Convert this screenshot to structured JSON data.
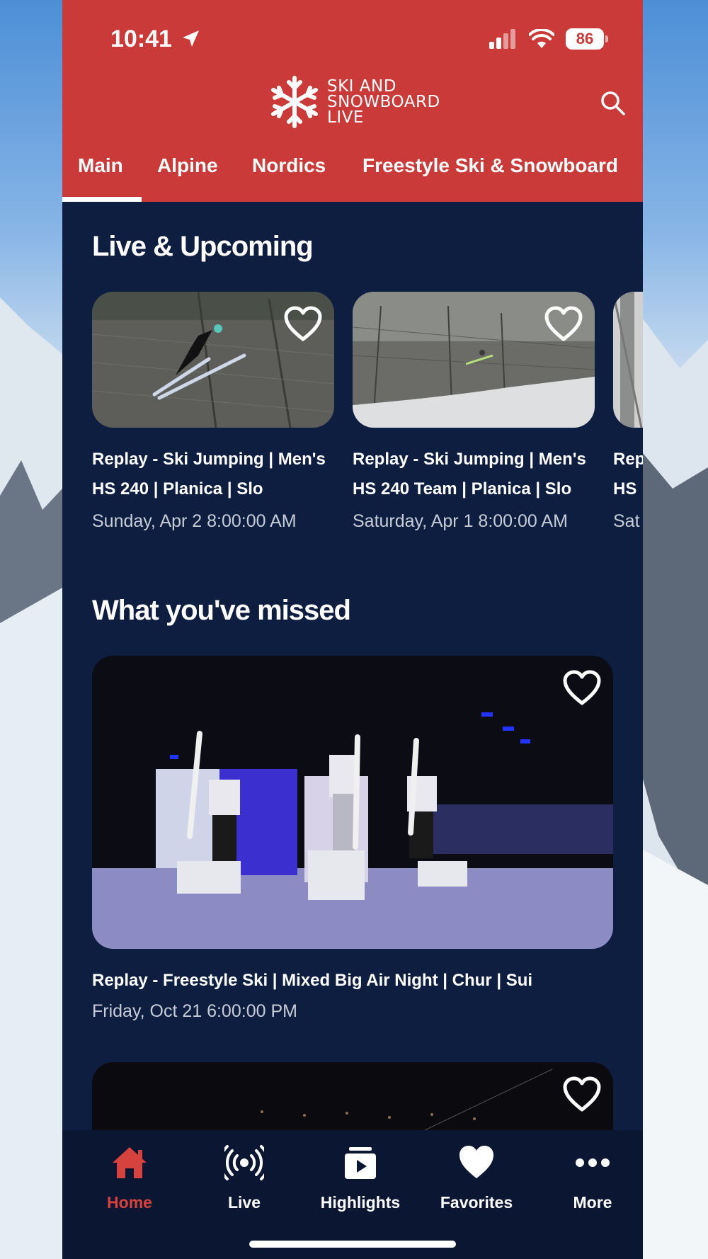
{
  "status": {
    "time": "10:41",
    "battery": "86"
  },
  "brand": {
    "line1": "SKI AND",
    "line2": "SNOWBOARD",
    "line3": "LIVE"
  },
  "tabs": [
    {
      "label": "Main"
    },
    {
      "label": "Alpine"
    },
    {
      "label": "Nordics"
    },
    {
      "label": "Freestyle Ski & Snowboard"
    }
  ],
  "sections": {
    "live": {
      "title": "Live & Upcoming",
      "cards": [
        {
          "title1": "Replay - Ski Jumping | Men's",
          "title2": "HS 240 | Planica | Slo",
          "date": "Sunday, Apr 2 8:00:00 AM"
        },
        {
          "title1": "Replay - Ski Jumping | Men's",
          "title2": "HS 240 Team | Planica | Slo",
          "date": "Saturday, Apr 1 8:00:00 AM"
        },
        {
          "title1": "Rep",
          "title2": "HS",
          "date": "Sat"
        }
      ]
    },
    "missed": {
      "title": "What you've missed",
      "cards": [
        {
          "title": "Replay - Freestyle Ski | Mixed Big Air Night | Chur | Sui",
          "date": "Friday, Oct 21 6:00:00 PM"
        }
      ]
    }
  },
  "tabbar": [
    {
      "label": "Home",
      "icon": "home-icon"
    },
    {
      "label": "Live",
      "icon": "broadcast-icon"
    },
    {
      "label": "Highlights",
      "icon": "highlights-icon"
    },
    {
      "label": "Favorites",
      "icon": "heart-icon"
    },
    {
      "label": "More",
      "icon": "more-icon"
    }
  ],
  "colors": {
    "header": "#c93a38",
    "background": "#0e1e40",
    "active": "#d6423d"
  }
}
